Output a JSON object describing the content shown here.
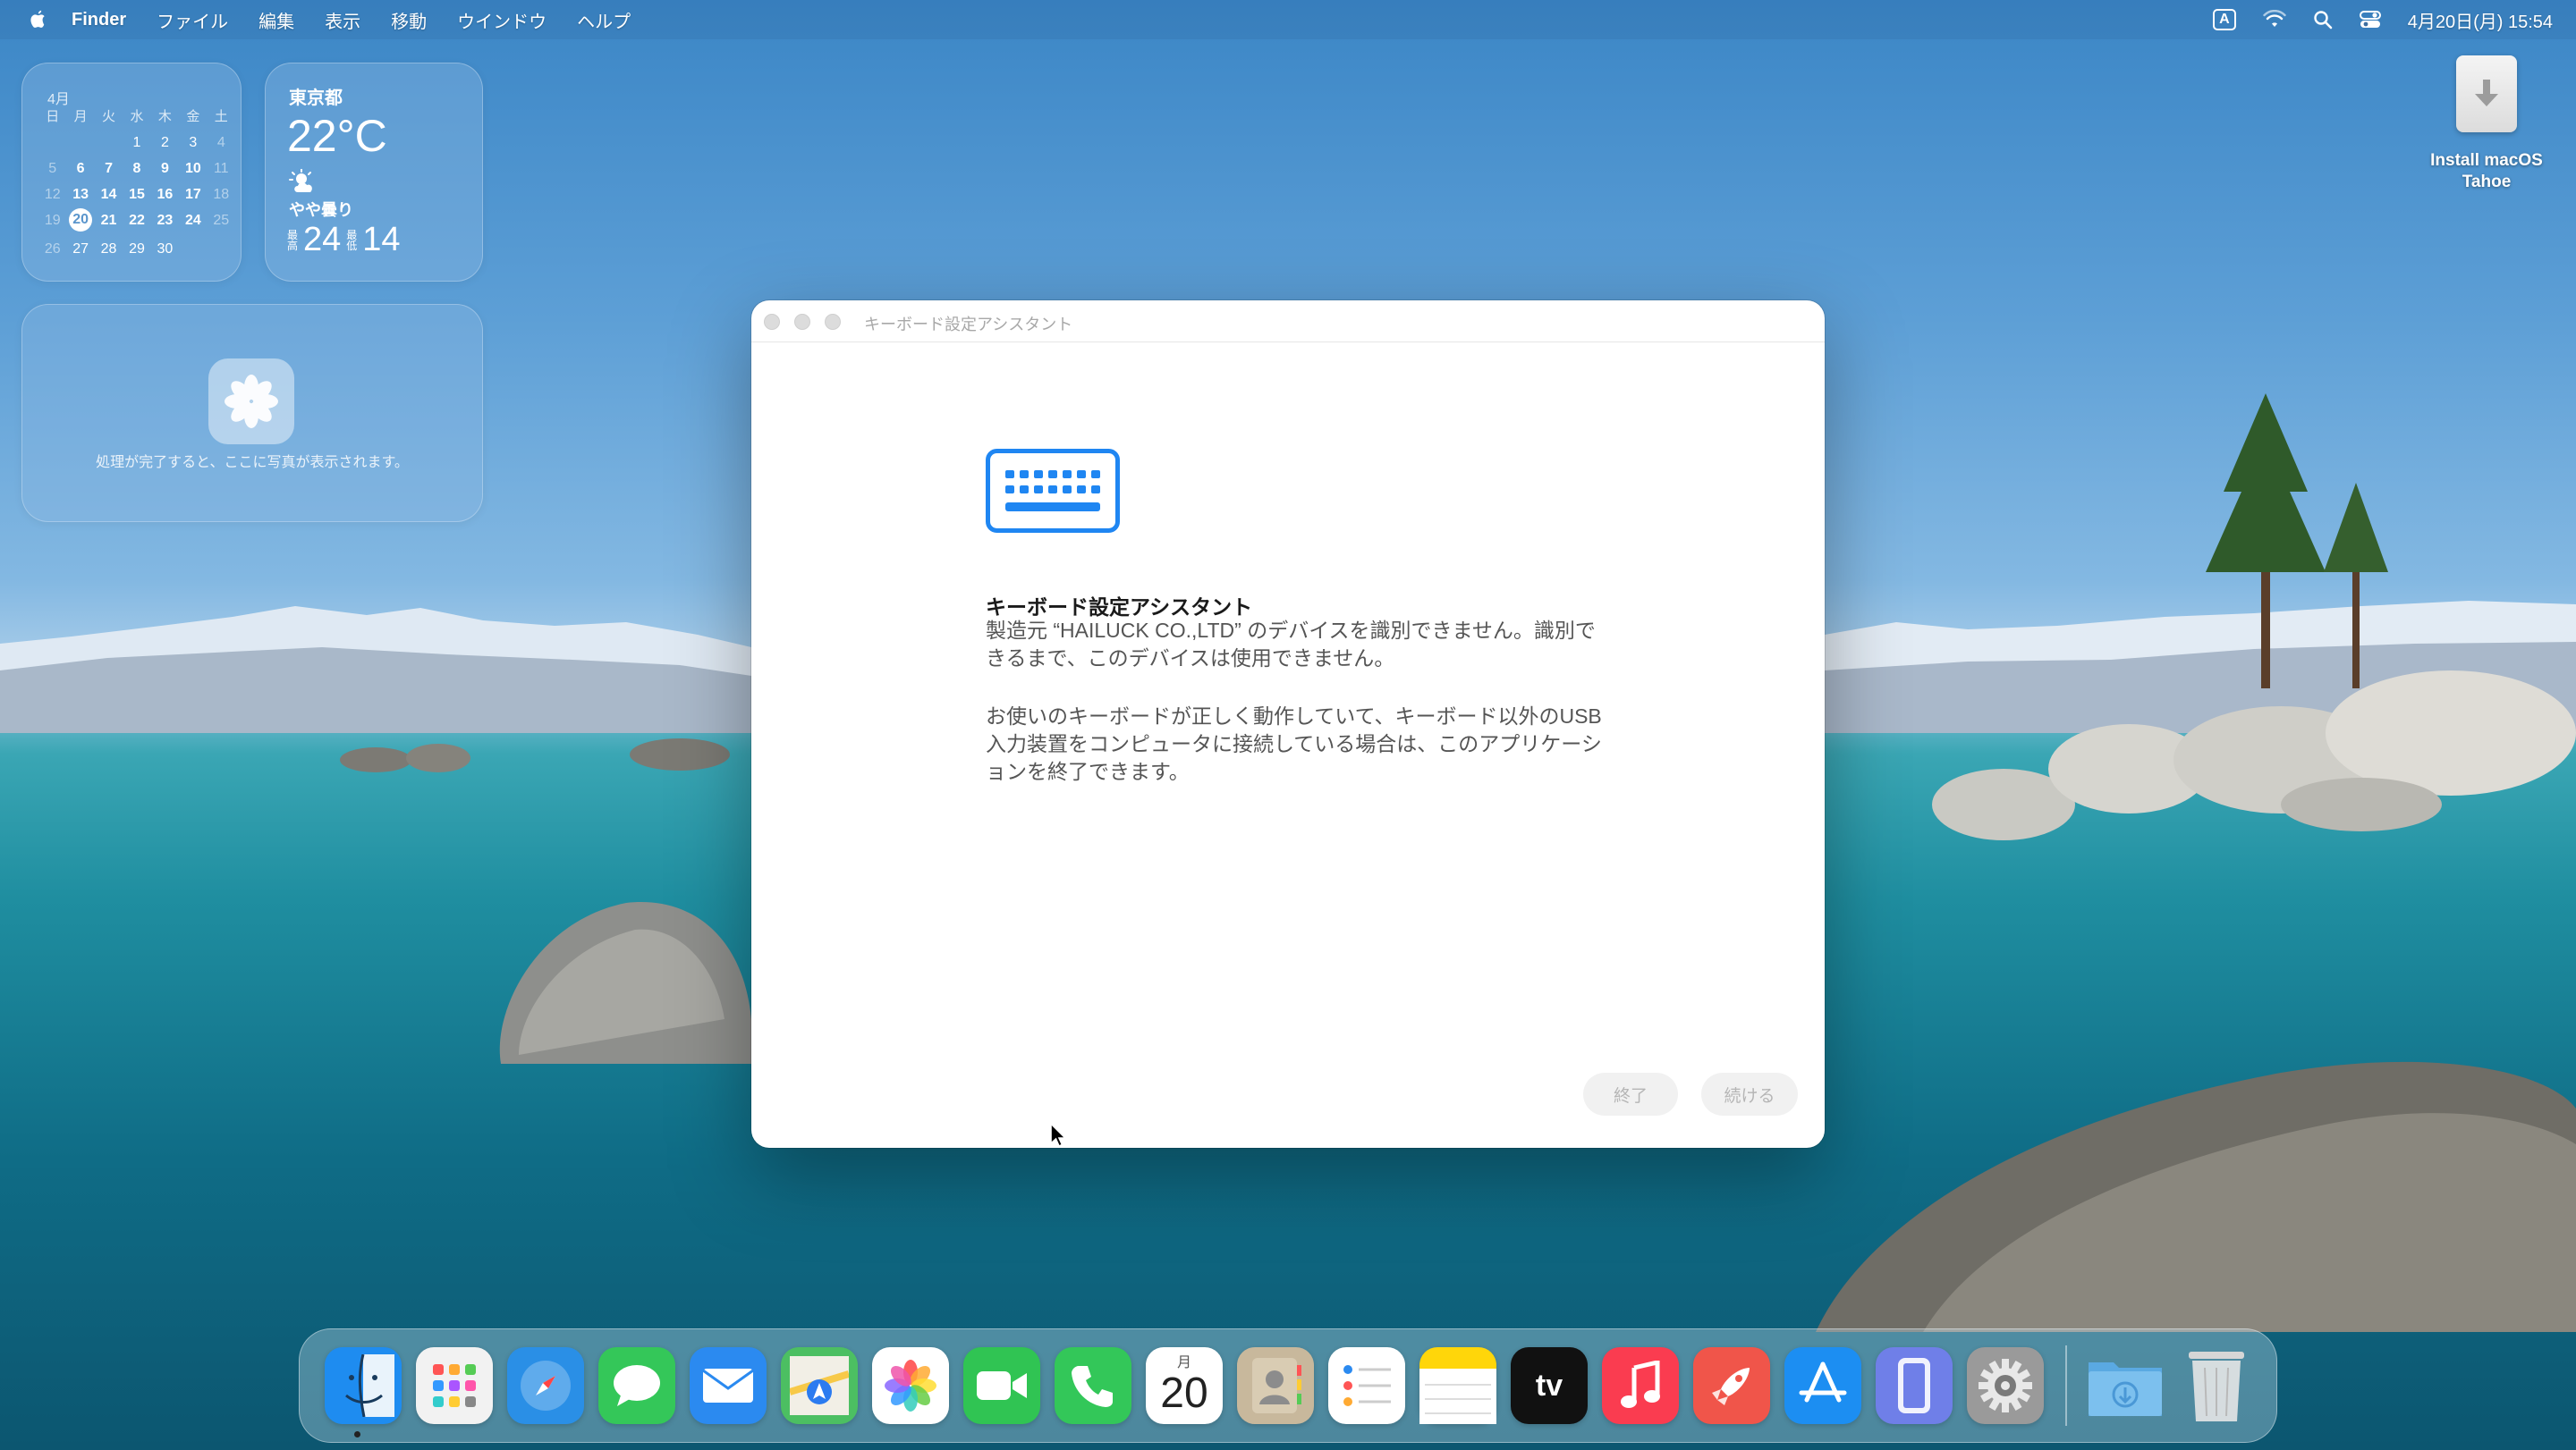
{
  "menubar": {
    "app_name": "Finder",
    "items": [
      "ファイル",
      "編集",
      "表示",
      "移動",
      "ウインドウ",
      "ヘルプ"
    ],
    "ime_indicator": "A",
    "datetime": "4月20日(月) 15:54",
    "status_icons": [
      "ime-icon",
      "wifi-icon",
      "spotlight-search-icon",
      "control-center-icon"
    ]
  },
  "calendar_widget": {
    "month": "4月",
    "weekdays": [
      "日",
      "月",
      "火",
      "水",
      "木",
      "金",
      "土"
    ],
    "days": [
      "",
      "",
      "",
      "1",
      "2",
      "3",
      "4",
      "5",
      "6",
      "7",
      "8",
      "9",
      "10",
      "11",
      "12",
      "13",
      "14",
      "15",
      "16",
      "17",
      "18",
      "19",
      "20",
      "21",
      "22",
      "23",
      "24",
      "25",
      "26",
      "27",
      "28",
      "29",
      "30"
    ],
    "today": "20"
  },
  "weather_widget": {
    "city": "東京都",
    "temperature": "22°C",
    "condition": "やや曇り",
    "high_label": "最高",
    "high": "24",
    "low_label": "最低",
    "low": "14",
    "condition_icon": "partly-cloudy-icon"
  },
  "photos_widget": {
    "message": "処理が完了すると、ここに写真が表示されます。",
    "icon": "photos-icon"
  },
  "desktop_icons": [
    {
      "label_line1": "Install macOS",
      "label_line2": "Tahoe",
      "icon": "installer-icon"
    }
  ],
  "dialog": {
    "window_title": "キーボード設定アシスタント",
    "heading": "キーボード設定アシスタント",
    "paragraph1": "製造元 “HAILUCK CO.,LTD” のデバイスを識別できません。識別できるまで、このデバイスは使用できません。",
    "paragraph2": "お使いのキーボードが正しく動作していて、キーボード以外のUSB入力装置をコンピュータに接続している場合は、このアプリケーションを終了できます。",
    "quit_button": "終了",
    "continue_button": "続ける",
    "icon": "keyboard-icon"
  },
  "dock": {
    "apps": [
      {
        "name": "Finder",
        "icon": "finder-icon",
        "color": "#1e8cf0"
      },
      {
        "name": "Launchpad",
        "icon": "launchpad-icon",
        "color": "#f2f2f2"
      },
      {
        "name": "Safari",
        "icon": "safari-icon",
        "color": "#2a8fe6"
      },
      {
        "name": "Messages",
        "icon": "messages-icon",
        "color": "#34c759"
      },
      {
        "name": "Mail",
        "icon": "mail-icon",
        "color": "#2b8af0"
      },
      {
        "name": "Maps",
        "icon": "maps-icon",
        "color": "#4cbf62"
      },
      {
        "name": "Photos",
        "icon": "photos-icon",
        "color": "#ffffff"
      },
      {
        "name": "FaceTime",
        "icon": "facetime-icon",
        "color": "#30c453"
      },
      {
        "name": "Phone",
        "icon": "phone-icon",
        "color": "#33c759"
      },
      {
        "name": "Calendar",
        "icon": "calendar-icon",
        "color": "#ffffff",
        "month": "月",
        "day": "20"
      },
      {
        "name": "Contacts",
        "icon": "contacts-icon",
        "color": "#c8b89c"
      },
      {
        "name": "Reminders",
        "icon": "reminders-icon",
        "color": "#ffffff"
      },
      {
        "name": "Notes",
        "icon": "notes-icon",
        "color": "#ffd60a"
      },
      {
        "name": "TV",
        "icon": "apple-tv-icon",
        "color": "#111111",
        "text": "tv"
      },
      {
        "name": "Music",
        "icon": "music-icon",
        "color": "#fa3c50"
      },
      {
        "name": "Rocket",
        "icon": "rocket-icon",
        "color": "#f0554a"
      },
      {
        "name": "App Store",
        "icon": "app-store-icon",
        "color": "#1c8ef2"
      },
      {
        "name": "iPhone Mirroring",
        "icon": "iphone-mirroring-icon",
        "color": "#6f7fe8"
      },
      {
        "name": "System Settings",
        "icon": "system-settings-icon",
        "color": "#9a9a9a"
      }
    ],
    "downloads": {
      "icon": "downloads-folder-icon",
      "color": "#7cc0ee"
    },
    "trash": {
      "icon": "trash-icon",
      "color": "#e6e6e6"
    }
  }
}
